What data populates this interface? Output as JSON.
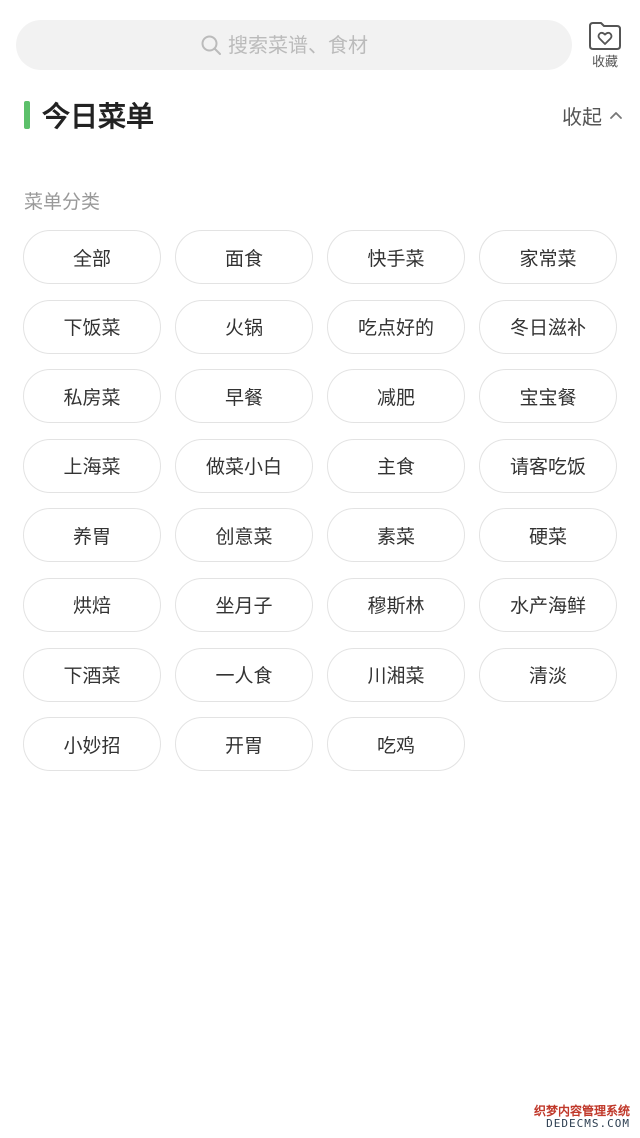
{
  "search": {
    "placeholder": "搜索菜谱、食材"
  },
  "favorites": {
    "label": "收藏"
  },
  "menu": {
    "title": "今日菜单",
    "collapse_label": "收起",
    "accent_color": "#5cc06a"
  },
  "categories": {
    "label": "菜单分类",
    "items": [
      "全部",
      "面食",
      "快手菜",
      "家常菜",
      "下饭菜",
      "火锅",
      "吃点好的",
      "冬日滋补",
      "私房菜",
      "早餐",
      "减肥",
      "宝宝餐",
      "上海菜",
      "做菜小白",
      "主食",
      "请客吃饭",
      "养胃",
      "创意菜",
      "素菜",
      "硬菜",
      "烘焙",
      "坐月子",
      "穆斯林",
      "水产海鲜",
      "下酒菜",
      "一人食",
      "川湘菜",
      "清淡",
      "小妙招",
      "开胃",
      "吃鸡"
    ]
  },
  "watermark": {
    "line1": "织梦内容管理系统",
    "line2": "DEDECMS.COM"
  }
}
